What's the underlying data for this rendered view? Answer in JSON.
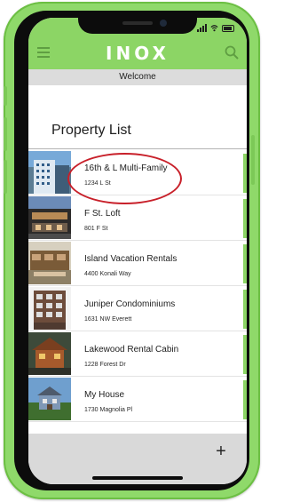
{
  "app": {
    "brand": "INOX",
    "welcome_text": "Welcome"
  },
  "page": {
    "title": "Property List"
  },
  "properties": [
    {
      "name": "16th & L Multi-Family",
      "address": "1234 L St",
      "thumbnail": "modern-apartment-building-photo",
      "highlighted": true
    },
    {
      "name": "F St. Loft",
      "address": "801 F St",
      "thumbnail": "loft-building-photo"
    },
    {
      "name": "Island Vacation Rentals",
      "address": "4400 Konali Way",
      "thumbnail": "vacation-house-photo"
    },
    {
      "name": "Juniper Condominiums",
      "address": "1631 NW Everett",
      "thumbnail": "brick-condo-photo"
    },
    {
      "name": "Lakewood Rental Cabin",
      "address": "1228 Forest Dr",
      "thumbnail": "cabin-photo"
    },
    {
      "name": "My House",
      "address": "1730 Magnolia Pl",
      "thumbnail": "house-photo"
    }
  ],
  "toolbar": {
    "add_label": "+"
  },
  "icons": {
    "menu": "hamburger-menu-icon",
    "search": "search-icon",
    "add": "plus-icon",
    "status": [
      "signal-icon",
      "wifi-icon",
      "battery-icon"
    ]
  },
  "colors": {
    "accent_green": "#8cd565",
    "phone_frame_green": "#8fd96a",
    "welcome_bar": "#dcdcdc",
    "highlight_red": "#c8202a",
    "footer_gray": "#d9d9d9"
  }
}
